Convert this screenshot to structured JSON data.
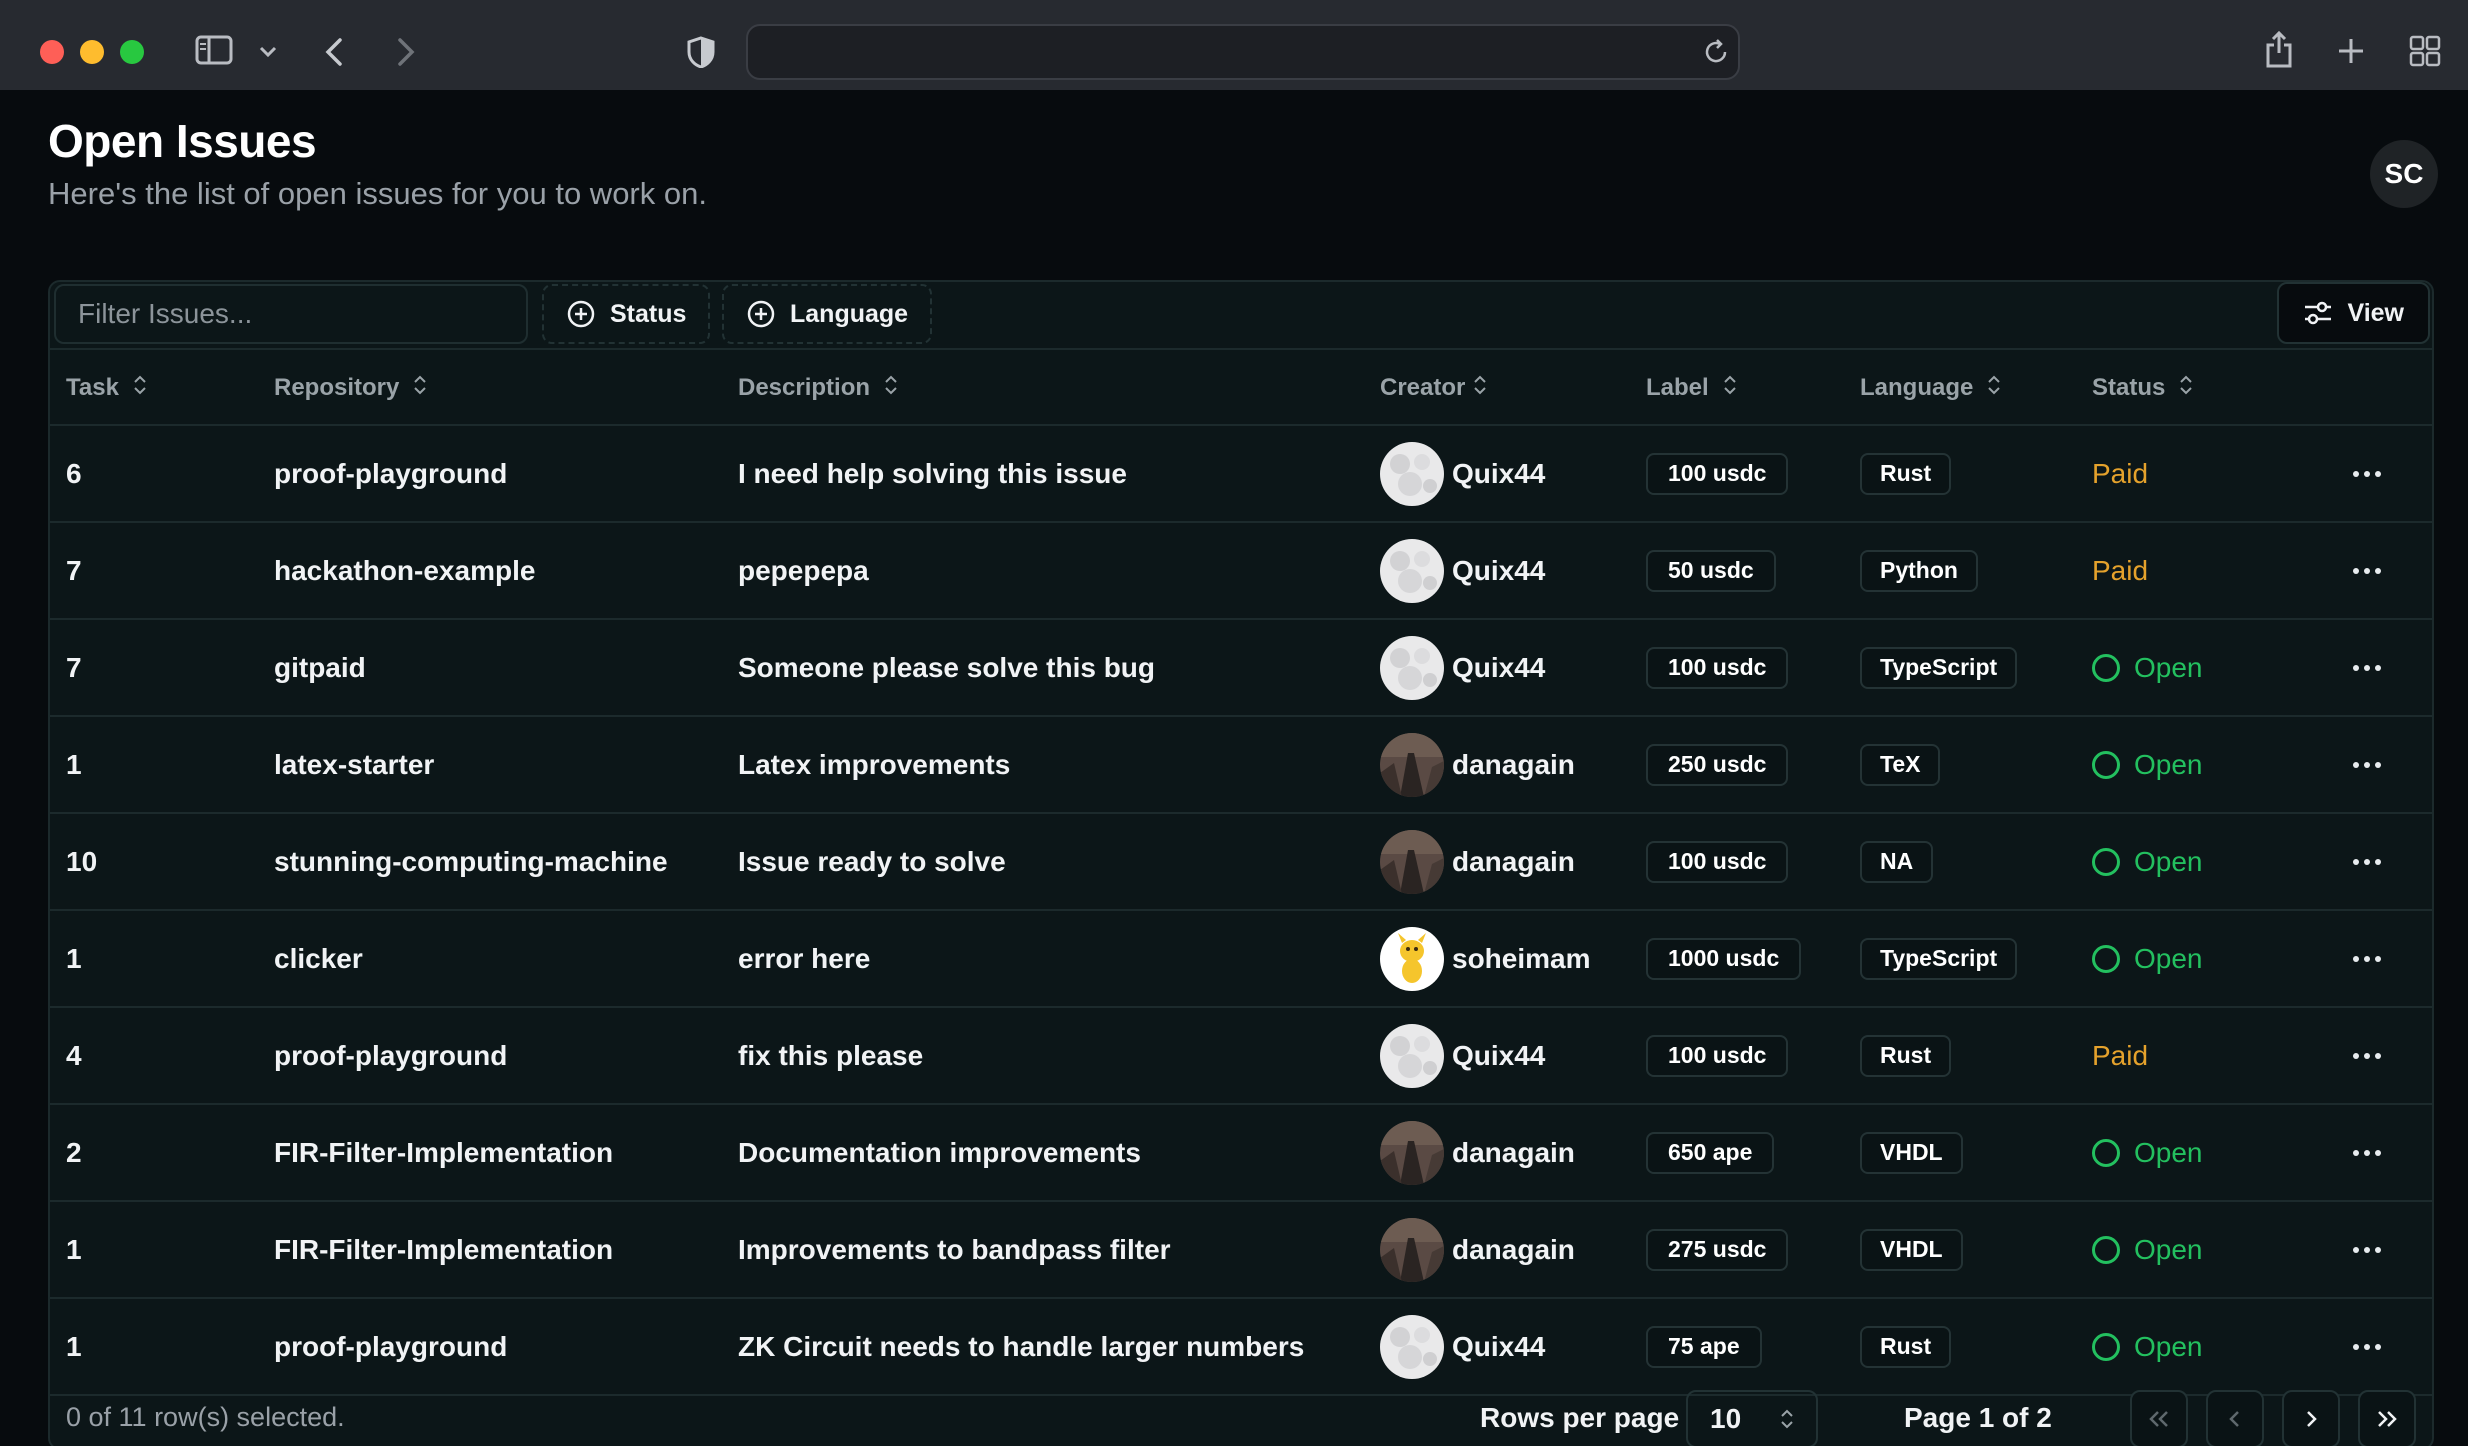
{
  "browser": {
    "url_value": "",
    "icons": [
      "sidebar-icon",
      "chevron-down-icon",
      "back-icon",
      "forward-icon",
      "shield-icon",
      "reload-icon",
      "share-icon",
      "new-tab-icon",
      "tab-overview-icon"
    ]
  },
  "header": {
    "title": "Open Issues",
    "subtitle": "Here's the list of open issues for you to work on.",
    "user_initials": "SC"
  },
  "toolbar": {
    "filter_placeholder": "Filter Issues...",
    "status_label": "Status",
    "language_label": "Language",
    "view_label": "View"
  },
  "columns": {
    "task": "Task",
    "repository": "Repository",
    "description": "Description",
    "creator": "Creator",
    "label": "Label",
    "language": "Language",
    "status": "Status"
  },
  "rows": [
    {
      "task": "6",
      "repository": "proof-playground",
      "description": "I need help solving this issue",
      "creator": "Quix44",
      "avatar": "quix",
      "label": "100 usdc",
      "language": "Rust",
      "status": "Paid"
    },
    {
      "task": "7",
      "repository": "hackathon-example",
      "description": "pepepepa",
      "creator": "Quix44",
      "avatar": "quix",
      "label": "50 usdc",
      "language": "Python",
      "status": "Paid"
    },
    {
      "task": "7",
      "repository": "gitpaid",
      "description": "Someone please solve this bug",
      "creator": "Quix44",
      "avatar": "quix",
      "label": "100 usdc",
      "language": "TypeScript",
      "status": "Open"
    },
    {
      "task": "1",
      "repository": "latex-starter",
      "description": "Latex improvements",
      "creator": "danagain",
      "avatar": "dana",
      "label": "250 usdc",
      "language": "TeX",
      "status": "Open"
    },
    {
      "task": "10",
      "repository": "stunning-computing-machine",
      "description": "Issue ready to solve",
      "creator": "danagain",
      "avatar": "dana",
      "label": "100 usdc",
      "language": "NA",
      "status": "Open"
    },
    {
      "task": "1",
      "repository": "clicker",
      "description": "error here",
      "creator": "soheimam",
      "avatar": "sohei",
      "label": "1000 usdc",
      "language": "TypeScript",
      "status": "Open"
    },
    {
      "task": "4",
      "repository": "proof-playground",
      "description": "fix this please",
      "creator": "Quix44",
      "avatar": "quix",
      "label": "100 usdc",
      "language": "Rust",
      "status": "Paid"
    },
    {
      "task": "2",
      "repository": "FIR-Filter-Implementation",
      "description": "Documentation improvements",
      "creator": "danagain",
      "avatar": "dana",
      "label": "650 ape",
      "language": "VHDL",
      "status": "Open"
    },
    {
      "task": "1",
      "repository": "FIR-Filter-Implementation",
      "description": "Improvements to bandpass filter",
      "creator": "danagain",
      "avatar": "dana",
      "label": "275 usdc",
      "language": "VHDL",
      "status": "Open"
    },
    {
      "task": "1",
      "repository": "proof-playground",
      "description": "ZK Circuit needs to handle larger numbers",
      "creator": "Quix44",
      "avatar": "quix",
      "label": "75 ape",
      "language": "Rust",
      "status": "Open"
    }
  ],
  "footer": {
    "selection": "0 of 11 row(s) selected.",
    "rows_per_page_label": "Rows per page",
    "rows_per_page_value": "10",
    "page_info": "Page 1 of 2"
  },
  "colors": {
    "paid": "#e5a22c",
    "open": "#23c05f",
    "background": "#070b0e",
    "panel": "#0c1618"
  }
}
